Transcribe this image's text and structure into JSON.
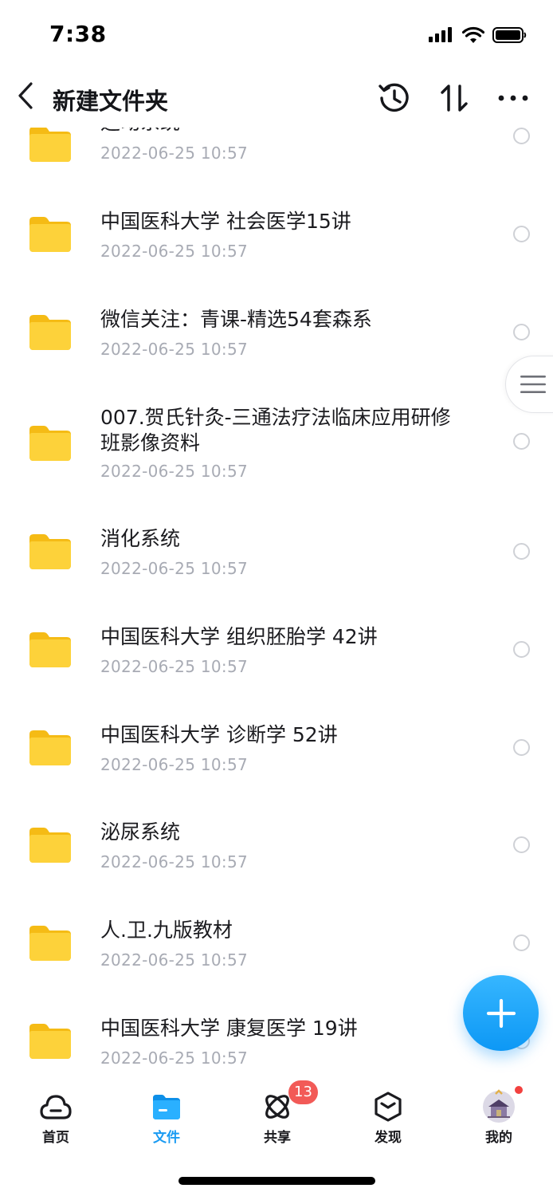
{
  "status": {
    "time": "7:38"
  },
  "nav": {
    "title": "新建文件夹"
  },
  "files": [
    {
      "name": "运动系统",
      "date": "2022-06-25 10:57"
    },
    {
      "name": "中国医科大学 社会医学15讲",
      "date": "2022-06-25 10:57"
    },
    {
      "name": "微信关注：青课-精选54套森系",
      "date": "2022-06-25 10:57"
    },
    {
      "name": "007.贺氏针灸-三通法疗法临床应用研修班影像资料",
      "date": "2022-06-25 10:57"
    },
    {
      "name": "消化系统",
      "date": "2022-06-25 10:57"
    },
    {
      "name": "中国医科大学 组织胚胎学 42讲",
      "date": "2022-06-25 10:57"
    },
    {
      "name": "中国医科大学 诊断学 52讲",
      "date": "2022-06-25 10:57"
    },
    {
      "name": "泌尿系统",
      "date": "2022-06-25 10:57"
    },
    {
      "name": "人.卫.九版教材",
      "date": "2022-06-25 10:57"
    },
    {
      "name": "中国医科大学 康复医学 19讲",
      "date": "2022-06-25 10:57"
    }
  ],
  "tabs": [
    {
      "label": "首页",
      "icon": "cloud-home-icon"
    },
    {
      "label": "文件",
      "icon": "folder-icon"
    },
    {
      "label": "共享",
      "icon": "share-orbit-icon"
    },
    {
      "label": "发现",
      "icon": "discover-cube-icon"
    },
    {
      "label": "我的",
      "icon": "avatar"
    }
  ],
  "share_badge": "13",
  "colors": {
    "accent": "#1a9bf2",
    "folder": "#fcd230",
    "badge": "#f25a57"
  }
}
